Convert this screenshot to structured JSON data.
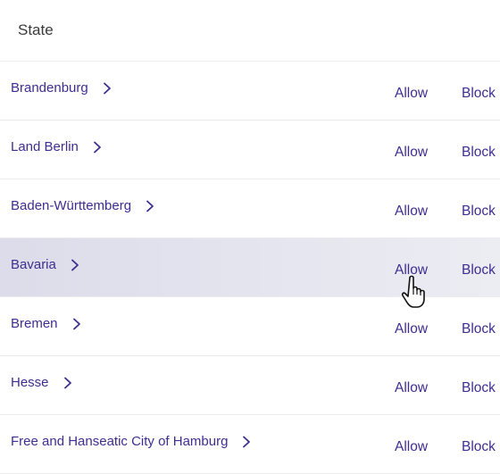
{
  "table": {
    "header": "State",
    "rows": [
      {
        "state": "Brandenburg",
        "allow": "Allow",
        "block": "Block"
      },
      {
        "state": "Land Berlin",
        "allow": "Allow",
        "block": "Block"
      },
      {
        "state": "Baden-Württemberg",
        "allow": "Allow",
        "block": "Block"
      },
      {
        "state": "Bavaria",
        "allow": "Allow",
        "block": "Block"
      },
      {
        "state": "Bremen",
        "allow": "Allow",
        "block": "Block"
      },
      {
        "state": "Hesse",
        "allow": "Allow",
        "block": "Block"
      },
      {
        "state": "Free and Hanseatic City of Hamburg",
        "allow": "Allow",
        "block": "Block"
      }
    ],
    "hovered_row": 3
  },
  "colors": {
    "link": "#3f2d8f",
    "hover_bg": "#e2e2ee",
    "divider": "#ececf0"
  },
  "cursor": {
    "icon": "hand-pointer-icon"
  }
}
